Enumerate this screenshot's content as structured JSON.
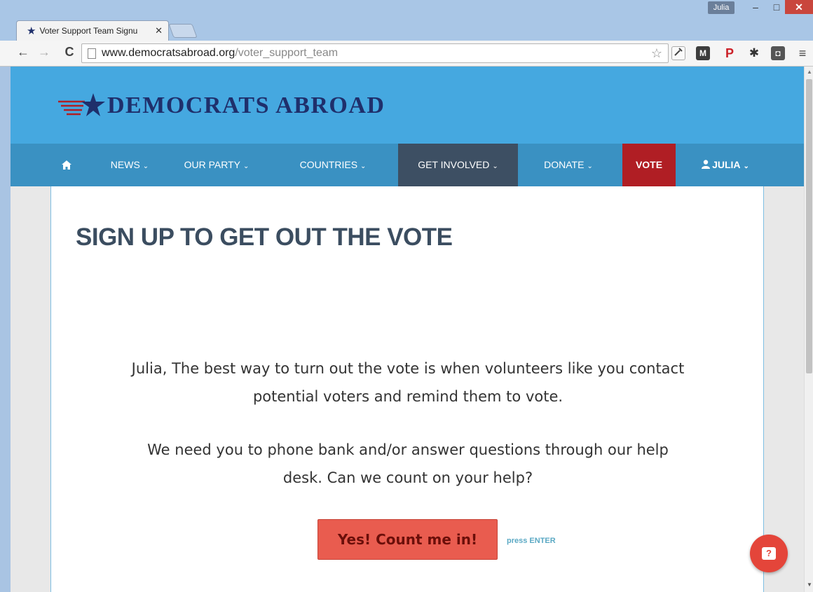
{
  "browser": {
    "tab_title": "Voter Support Team Signu",
    "tab_close": "✕",
    "profile_name": "Julia",
    "url_host": "www.democratsabroad.org",
    "url_path": "/voter_support_team",
    "window_buttons": {
      "minimize": "–",
      "maximize": "□",
      "close": "✕"
    },
    "nav": {
      "back": "←",
      "forward": "→",
      "reload": "C"
    },
    "icons": {
      "bookmark_star": "☆",
      "gmail": "M",
      "pinterest": "P",
      "settings": "✱",
      "pocket": "◘",
      "menu": "≡"
    }
  },
  "site": {
    "logo_text": "DEMOCRATS ABROAD",
    "colors": {
      "header": "#45a8e0",
      "nav": "#3a91c2",
      "nav_active": "#3d4f63",
      "vote": "#b01e24",
      "cta": "#e95c4f",
      "logo": "#1f2f6b"
    },
    "nav": {
      "home_icon": "home-icon",
      "items": [
        {
          "label": "NEWS"
        },
        {
          "label": "OUR PARTY"
        },
        {
          "label": "COUNTRIES"
        },
        {
          "label": "GET INVOLVED",
          "active": true
        },
        {
          "label": "DONATE"
        },
        {
          "label": "VOTE"
        },
        {
          "label": "JULIA"
        }
      ]
    }
  },
  "main": {
    "title": "SIGN UP TO GET OUT THE VOTE",
    "paragraph1": "Julia, The best way to turn out the vote is when volunteers like you contact potential voters and remind them to vote.",
    "paragraph2": "We need you to phone bank and/or answer questions through our help desk.  Can we count on your help?",
    "cta_label": "Yes! Count me in!",
    "cta_hint": "press ENTER"
  }
}
